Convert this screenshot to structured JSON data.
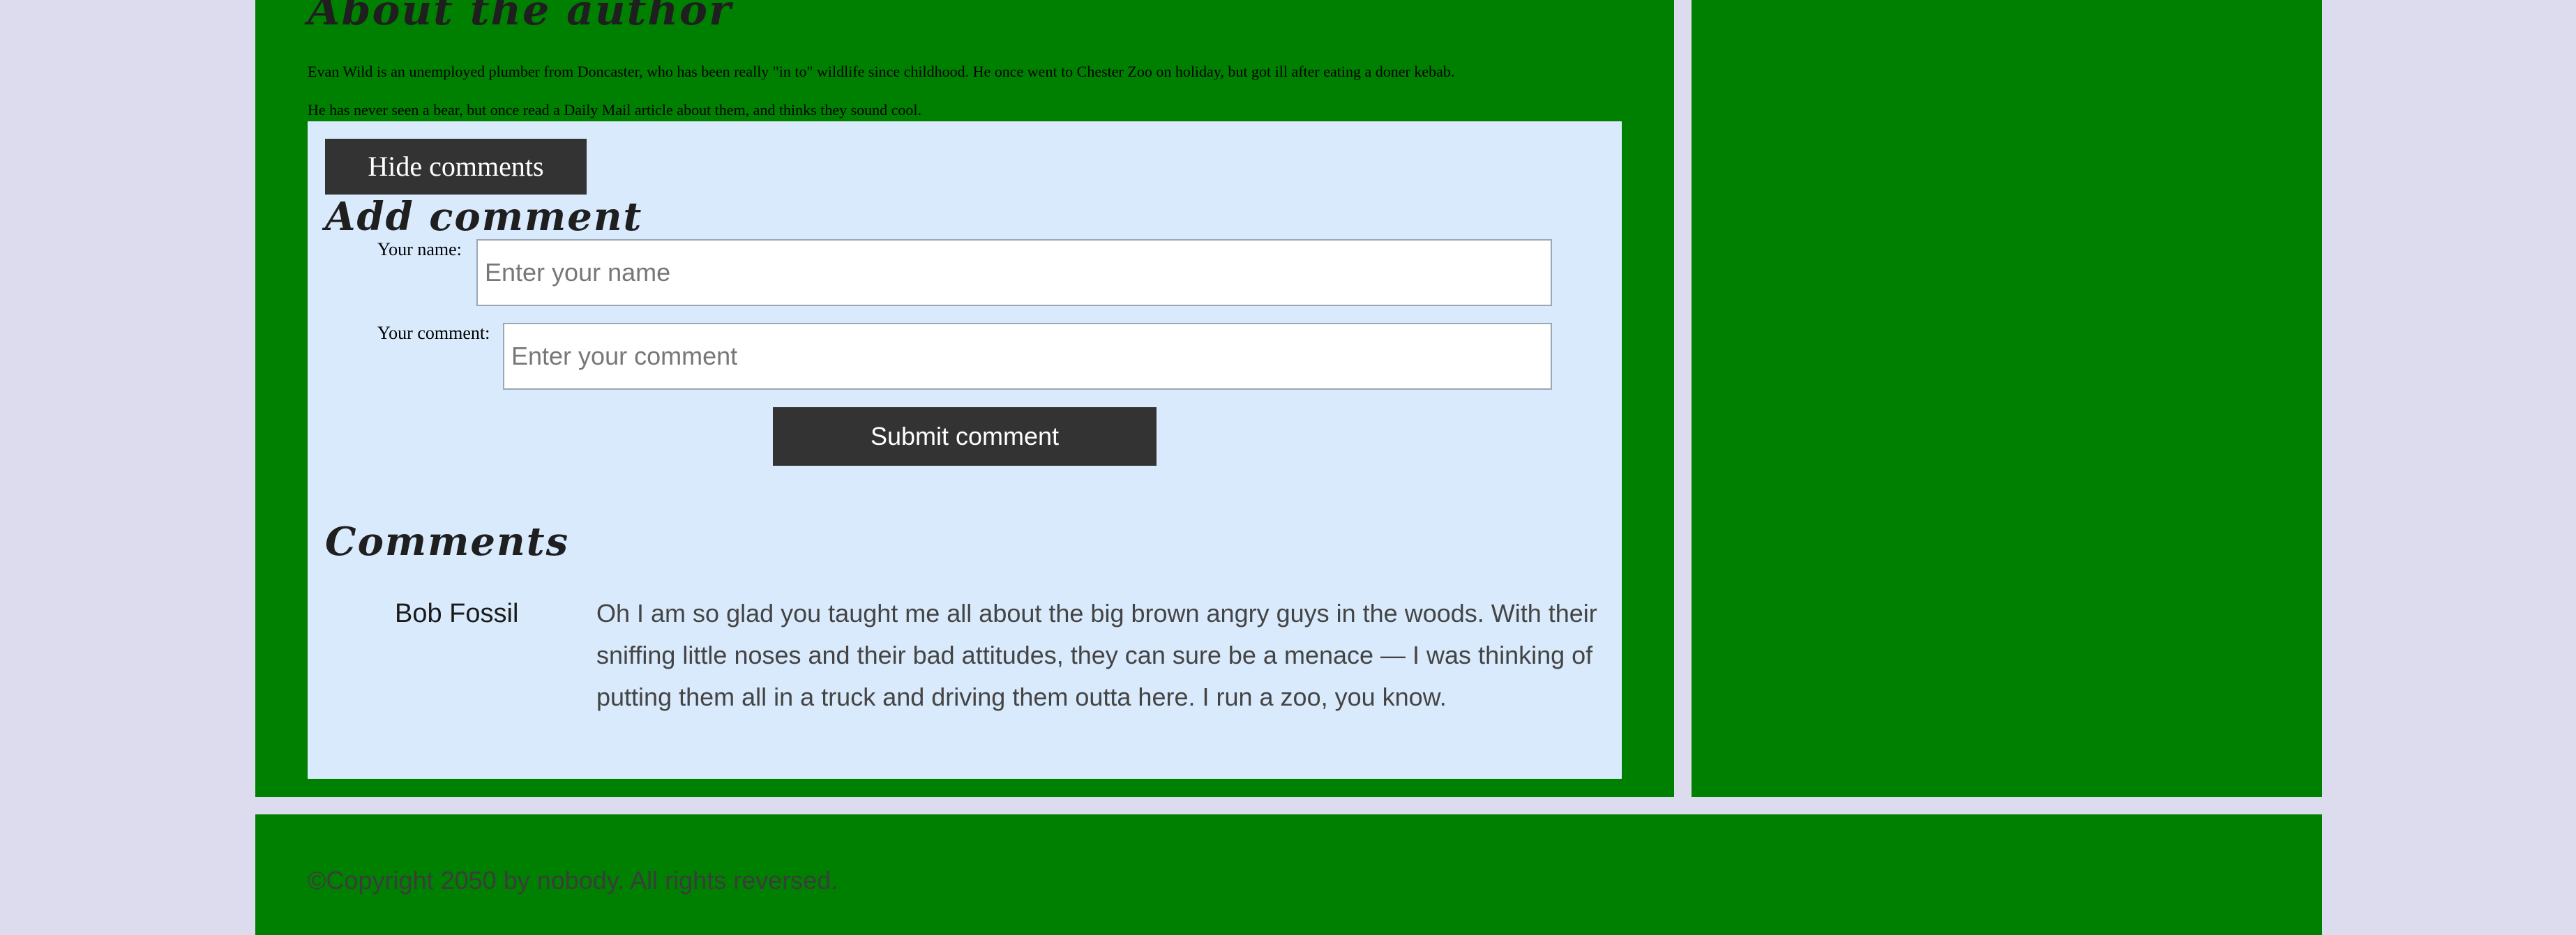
{
  "about": {
    "heading": "About the author",
    "line1": "Evan Wild is an unemployed plumber from Doncaster, who has been really \"in to\" wildlife since childhood. He once went to Chester Zoo on holiday, but got ill after eating a doner kebab.",
    "line2": "He has never seen a bear, but once read a Daily Mail article about them, and thinks they sound cool."
  },
  "comments_section": {
    "toggle_label": "Hide comments",
    "add_heading": "Add comment",
    "name_label": "Your name:",
    "name_value": "",
    "name_placeholder": "Enter your name",
    "comment_label": "Your comment:",
    "comment_value": "",
    "comment_placeholder": "Enter your comment",
    "submit_label": "Submit comment",
    "list_heading": "Comments",
    "comments": [
      {
        "author": "Bob Fossil",
        "text": "Oh I am so glad you taught me all about the big brown angry guys in the woods. With their sniffing little noses and their bad attitudes, they can sure be a menace — I was thinking of putting them all in a truck and driving them outta here. I run a zoo, you know."
      }
    ]
  },
  "footer": {
    "copyright": "©Copyright 2050 by nobody. All rights reversed."
  },
  "colors": {
    "page_bg": "#dcdcee",
    "panel_green": "#008000",
    "comments_bg": "#d9eafc",
    "button_dark": "#333333"
  }
}
